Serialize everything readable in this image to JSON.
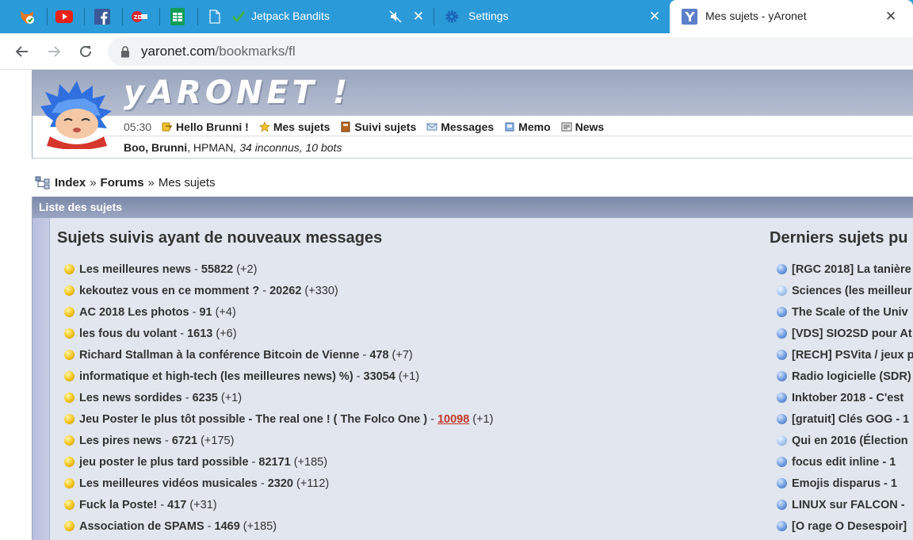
{
  "browser": {
    "tabs": [
      {
        "title": "Jetpack Bandits",
        "muted_icon": "muted-speaker-icon"
      },
      {
        "title": "Settings"
      },
      {
        "title": "Mes sujets - yAronet",
        "active": true
      }
    ],
    "close_glyph": "✕",
    "url_host": "yaronet.com",
    "url_path": "/bookmarks/fl"
  },
  "header": {
    "logo_text": "yARONET !",
    "time": "05:30",
    "nav": [
      {
        "label": "Hello Brunni !",
        "icon": "key-icon"
      },
      {
        "label": "Mes sujets",
        "icon": "star-icon"
      },
      {
        "label": "Suivi sujets",
        "icon": "book-icon"
      },
      {
        "label": "Messages",
        "icon": "envelope-icon"
      },
      {
        "label": "Memo",
        "icon": "memo-icon"
      },
      {
        "label": "News",
        "icon": "newspaper-icon"
      }
    ],
    "online": {
      "users_bold": "Boo, Brunni",
      "sep": ", ",
      "users_other": "HPMAN",
      "guests": ", 34 inconnus, 10 bots"
    }
  },
  "breadcrumb": {
    "index": "Index",
    "forums": "Forums",
    "current": "Mes sujets",
    "sep": "»"
  },
  "panel": {
    "title": "Liste des sujets",
    "left": {
      "title": "Sujets suivis ayant de nouveaux messages",
      "topics": [
        {
          "name": "Les meilleures news",
          "count": "55822",
          "delta": "(+2)"
        },
        {
          "name": "kekoutez vous en ce momment ?",
          "count": "20262",
          "delta": "(+330)"
        },
        {
          "name": "AC 2018 Les photos",
          "count": "91",
          "delta": "(+4)"
        },
        {
          "name": "les fous du volant",
          "count": "1613",
          "delta": "(+6)"
        },
        {
          "name": "Richard Stallman à la conférence Bitcoin de Vienne",
          "count": "478",
          "delta": "(+7)"
        },
        {
          "name": "informatique et high-tech (les meilleures news) %)",
          "count": "33054",
          "delta": "(+1)"
        },
        {
          "name": "Les news sordides",
          "count": "6235",
          "delta": "(+1)"
        },
        {
          "name": "Jeu Poster le plus tôt possible - The real one ! ( The Folco One )",
          "count": "10098",
          "delta": "(+1)",
          "unread": true
        },
        {
          "name": "Les pires news",
          "count": "6721",
          "delta": "(+175)"
        },
        {
          "name": "jeu poster le plus tard possible",
          "count": "82171",
          "delta": "(+185)"
        },
        {
          "name": "Les meilleures vidéos musicales",
          "count": "2320",
          "delta": "(+112)"
        },
        {
          "name": "Fuck la Poste!",
          "count": "417",
          "delta": "(+31)"
        },
        {
          "name": "Association de SPAMS",
          "count": "1469",
          "delta": "(+185)"
        }
      ]
    },
    "right": {
      "title": "Derniers sujets pu",
      "topics": [
        {
          "name": "[RGC 2018] La tanière",
          "color": "blue"
        },
        {
          "name": "Sciences (les meilleur",
          "color": "lightblue"
        },
        {
          "name": "The Scale of the Univ",
          "color": "blue"
        },
        {
          "name": "[VDS] SIO2SD pour At",
          "color": "blue"
        },
        {
          "name": "[RECH] PSVita / jeux p",
          "color": "blue"
        },
        {
          "name": "Radio logicielle (SDR)",
          "color": "blue"
        },
        {
          "name": "Inktober 2018 - C'est",
          "color": "blue"
        },
        {
          "name": "[gratuit] Clés GOG - 1",
          "color": "blue"
        },
        {
          "name": "Qui en 2016 (Élection",
          "color": "lightblue"
        },
        {
          "name": "focus edit inline - 1",
          "color": "blue"
        },
        {
          "name": "Emojis disparus - 1",
          "color": "blue"
        },
        {
          "name": "LINUX sur FALCON -",
          "color": "blue"
        },
        {
          "name": "[O rage O Desespoir]",
          "color": "blue"
        }
      ]
    }
  }
}
